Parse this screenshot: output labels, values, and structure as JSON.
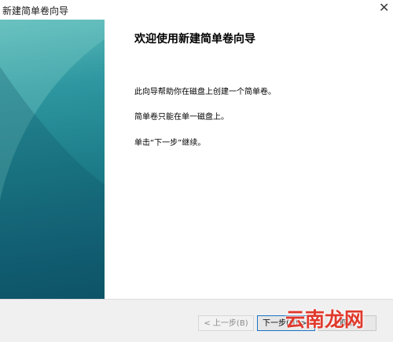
{
  "window": {
    "title": "新建简单卷向导"
  },
  "titlebar": {
    "close_icon": "close-icon"
  },
  "content": {
    "heading": "欢迎使用新建简单卷向导",
    "paragraph_1": "此向导帮助你在磁盘上创建一个简单卷。",
    "paragraph_2": "简单卷只能在单一磁盘上。",
    "paragraph_3": "单击“下一步”继续。"
  },
  "footer": {
    "back_label": "< 上一步(B)",
    "next_label": "下一步(N) >",
    "cancel_label": "取消"
  },
  "watermark": {
    "text": "云南龙网"
  },
  "colors": {
    "banner_dark": "#0f566a",
    "banner_light": "#5fbcbc",
    "focus_border": "#1a72c4",
    "watermark": "#e0392c"
  }
}
